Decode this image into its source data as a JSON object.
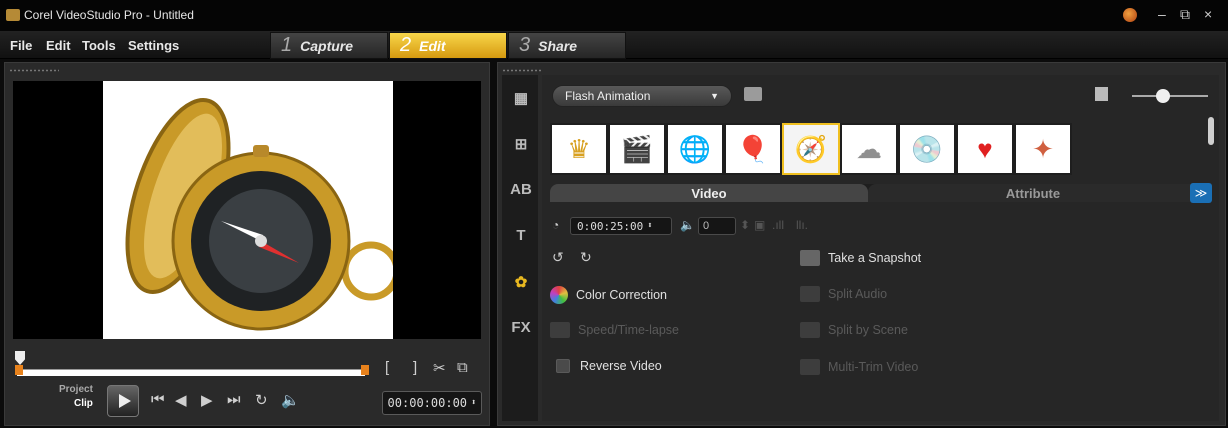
{
  "window": {
    "title": "Corel VideoStudio Pro - Untitled",
    "controls": [
      "–",
      "⧉",
      "×"
    ]
  },
  "menu": {
    "items": [
      "File",
      "Edit",
      "Tools",
      "Settings"
    ]
  },
  "steps": [
    {
      "num": "1",
      "label": "Capture",
      "active": false
    },
    {
      "num": "2",
      "label": "Edit",
      "active": true
    },
    {
      "num": "3",
      "label": "Share",
      "active": false
    }
  ],
  "player": {
    "project_label": "Project",
    "clip_label": "Clip",
    "timecode": "00:00:00:00",
    "trim_in": "[",
    "trim_out": "]"
  },
  "library": {
    "category": "Flash Animation",
    "thumbnails": [
      {
        "name": "crown",
        "glyph": "♛",
        "color": "#d8a020"
      },
      {
        "name": "clapperboard",
        "glyph": "🎬",
        "color": "#222222"
      },
      {
        "name": "globe",
        "glyph": "🌐",
        "color": "#3060c0"
      },
      {
        "name": "balloons",
        "glyph": "🎈",
        "color": "#e04040"
      },
      {
        "name": "compass",
        "glyph": "🧭",
        "color": "#c09020"
      },
      {
        "name": "cloud",
        "glyph": "☁",
        "color": "#909090"
      },
      {
        "name": "disc",
        "glyph": "💿",
        "color": "#c8b040"
      },
      {
        "name": "heart",
        "glyph": "♥",
        "color": "#e02020"
      },
      {
        "name": "sparkle",
        "glyph": "✦",
        "color": "#d06040"
      }
    ],
    "selected_index": 4
  },
  "tabs": {
    "video": "Video",
    "attribute": "Attribute"
  },
  "video_options": {
    "duration": "0:00:25:00",
    "volume": "0",
    "take_snapshot": "Take a Snapshot",
    "color_correction": "Color Correction",
    "split_audio": "Split Audio",
    "speed_timelapse": "Speed/Time-lapse",
    "split_by_scene": "Split by Scene",
    "reverse_video": "Reverse Video",
    "multi_trim_video": "Multi-Trim Video"
  },
  "colors": {
    "accent_active_step": "#f0c020",
    "trim_marker": "#e8821c",
    "expand_button": "#1a6fb5"
  }
}
